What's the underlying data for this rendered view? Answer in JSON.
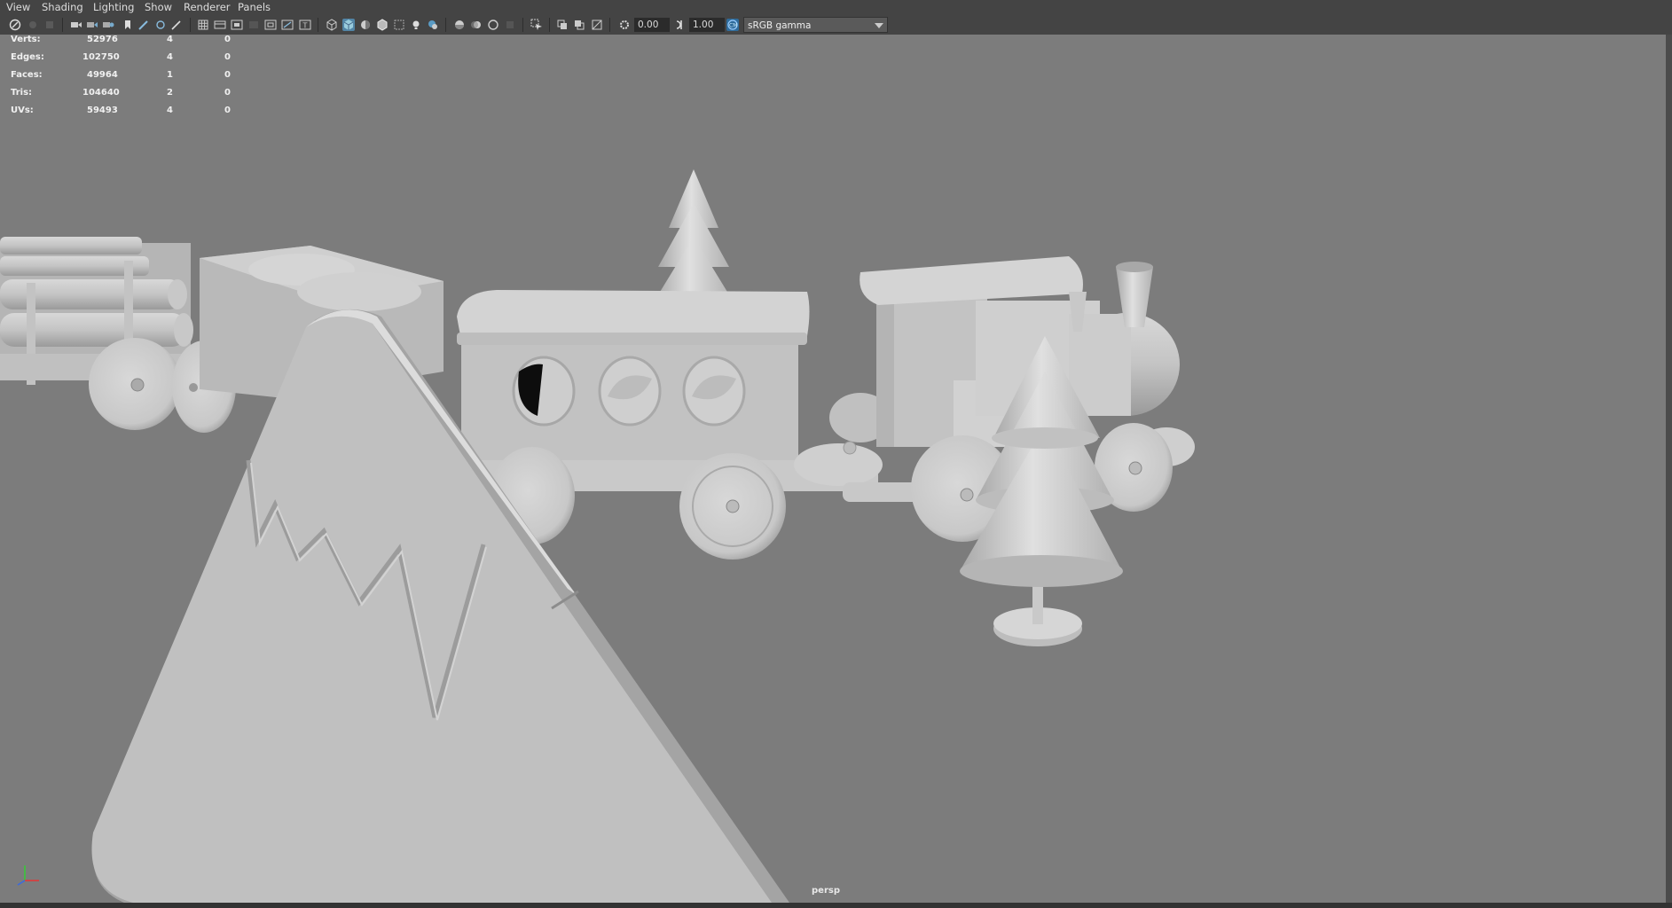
{
  "menubar": {
    "items": [
      "View",
      "Shading",
      "Lighting",
      "Show",
      "Renderer",
      "Panels"
    ]
  },
  "toolbar": {
    "exposure_value": "0.00",
    "gamma_value": "1.00",
    "colorspace": "sRGB gamma",
    "icons": [
      "select-camera-icon",
      "camera-attributes-icon",
      "bookmarks-icon",
      "image-plane-icon",
      "2d-pan-zoom-icon",
      "grease-pencil-icon",
      "grid-icon",
      "film-gate-icon",
      "resolution-gate-icon",
      "gate-mask-icon",
      "field-chart-icon",
      "safe-action-icon",
      "safe-title-icon",
      "wireframe-icon",
      "smooth-shade-icon",
      "default-material-icon",
      "wireframe-on-shaded-icon",
      "xray-icon",
      "use-all-lights-icon",
      "shadows-icon",
      "screen-space-ao-icon",
      "motion-blur-icon",
      "anti-aliasing-icon",
      "depth-of-field-icon",
      "isolate-select-icon",
      "xray-joints-icon",
      "xray-active-icon",
      "backface-culling-icon",
      "exposure-icon",
      "gamma-icon",
      "color-management-icon"
    ]
  },
  "hud": {
    "rows": [
      {
        "label": "Verts:",
        "total": "52976",
        "selected": "4",
        "faces_sel": "0"
      },
      {
        "label": "Edges:",
        "total": "102750",
        "selected": "4",
        "faces_sel": "0"
      },
      {
        "label": "Faces:",
        "total": "49964",
        "selected": "1",
        "faces_sel": "0"
      },
      {
        "label": "Tris:",
        "total": "104640",
        "selected": "2",
        "faces_sel": "0"
      },
      {
        "label": "UVs:",
        "total": "59493",
        "selected": "4",
        "faces_sel": "0"
      }
    ]
  },
  "viewport": {
    "camera": "persp",
    "background": "#7c7c7c"
  }
}
